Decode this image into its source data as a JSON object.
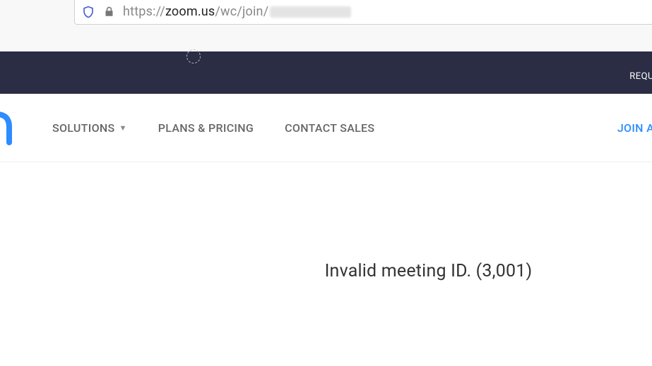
{
  "url": {
    "prefix": "https://",
    "host": "zoom.us",
    "path": "/wc/join/"
  },
  "top_banner": {
    "text": "REQU"
  },
  "nav": {
    "items": [
      {
        "label": "SOLUTIONS",
        "has_dropdown": true
      },
      {
        "label": "PLANS & PRICING",
        "has_dropdown": false
      },
      {
        "label": "CONTACT SALES",
        "has_dropdown": false
      }
    ],
    "right_action": "JOIN A"
  },
  "content": {
    "error": "Invalid meeting ID. (3,001)"
  }
}
